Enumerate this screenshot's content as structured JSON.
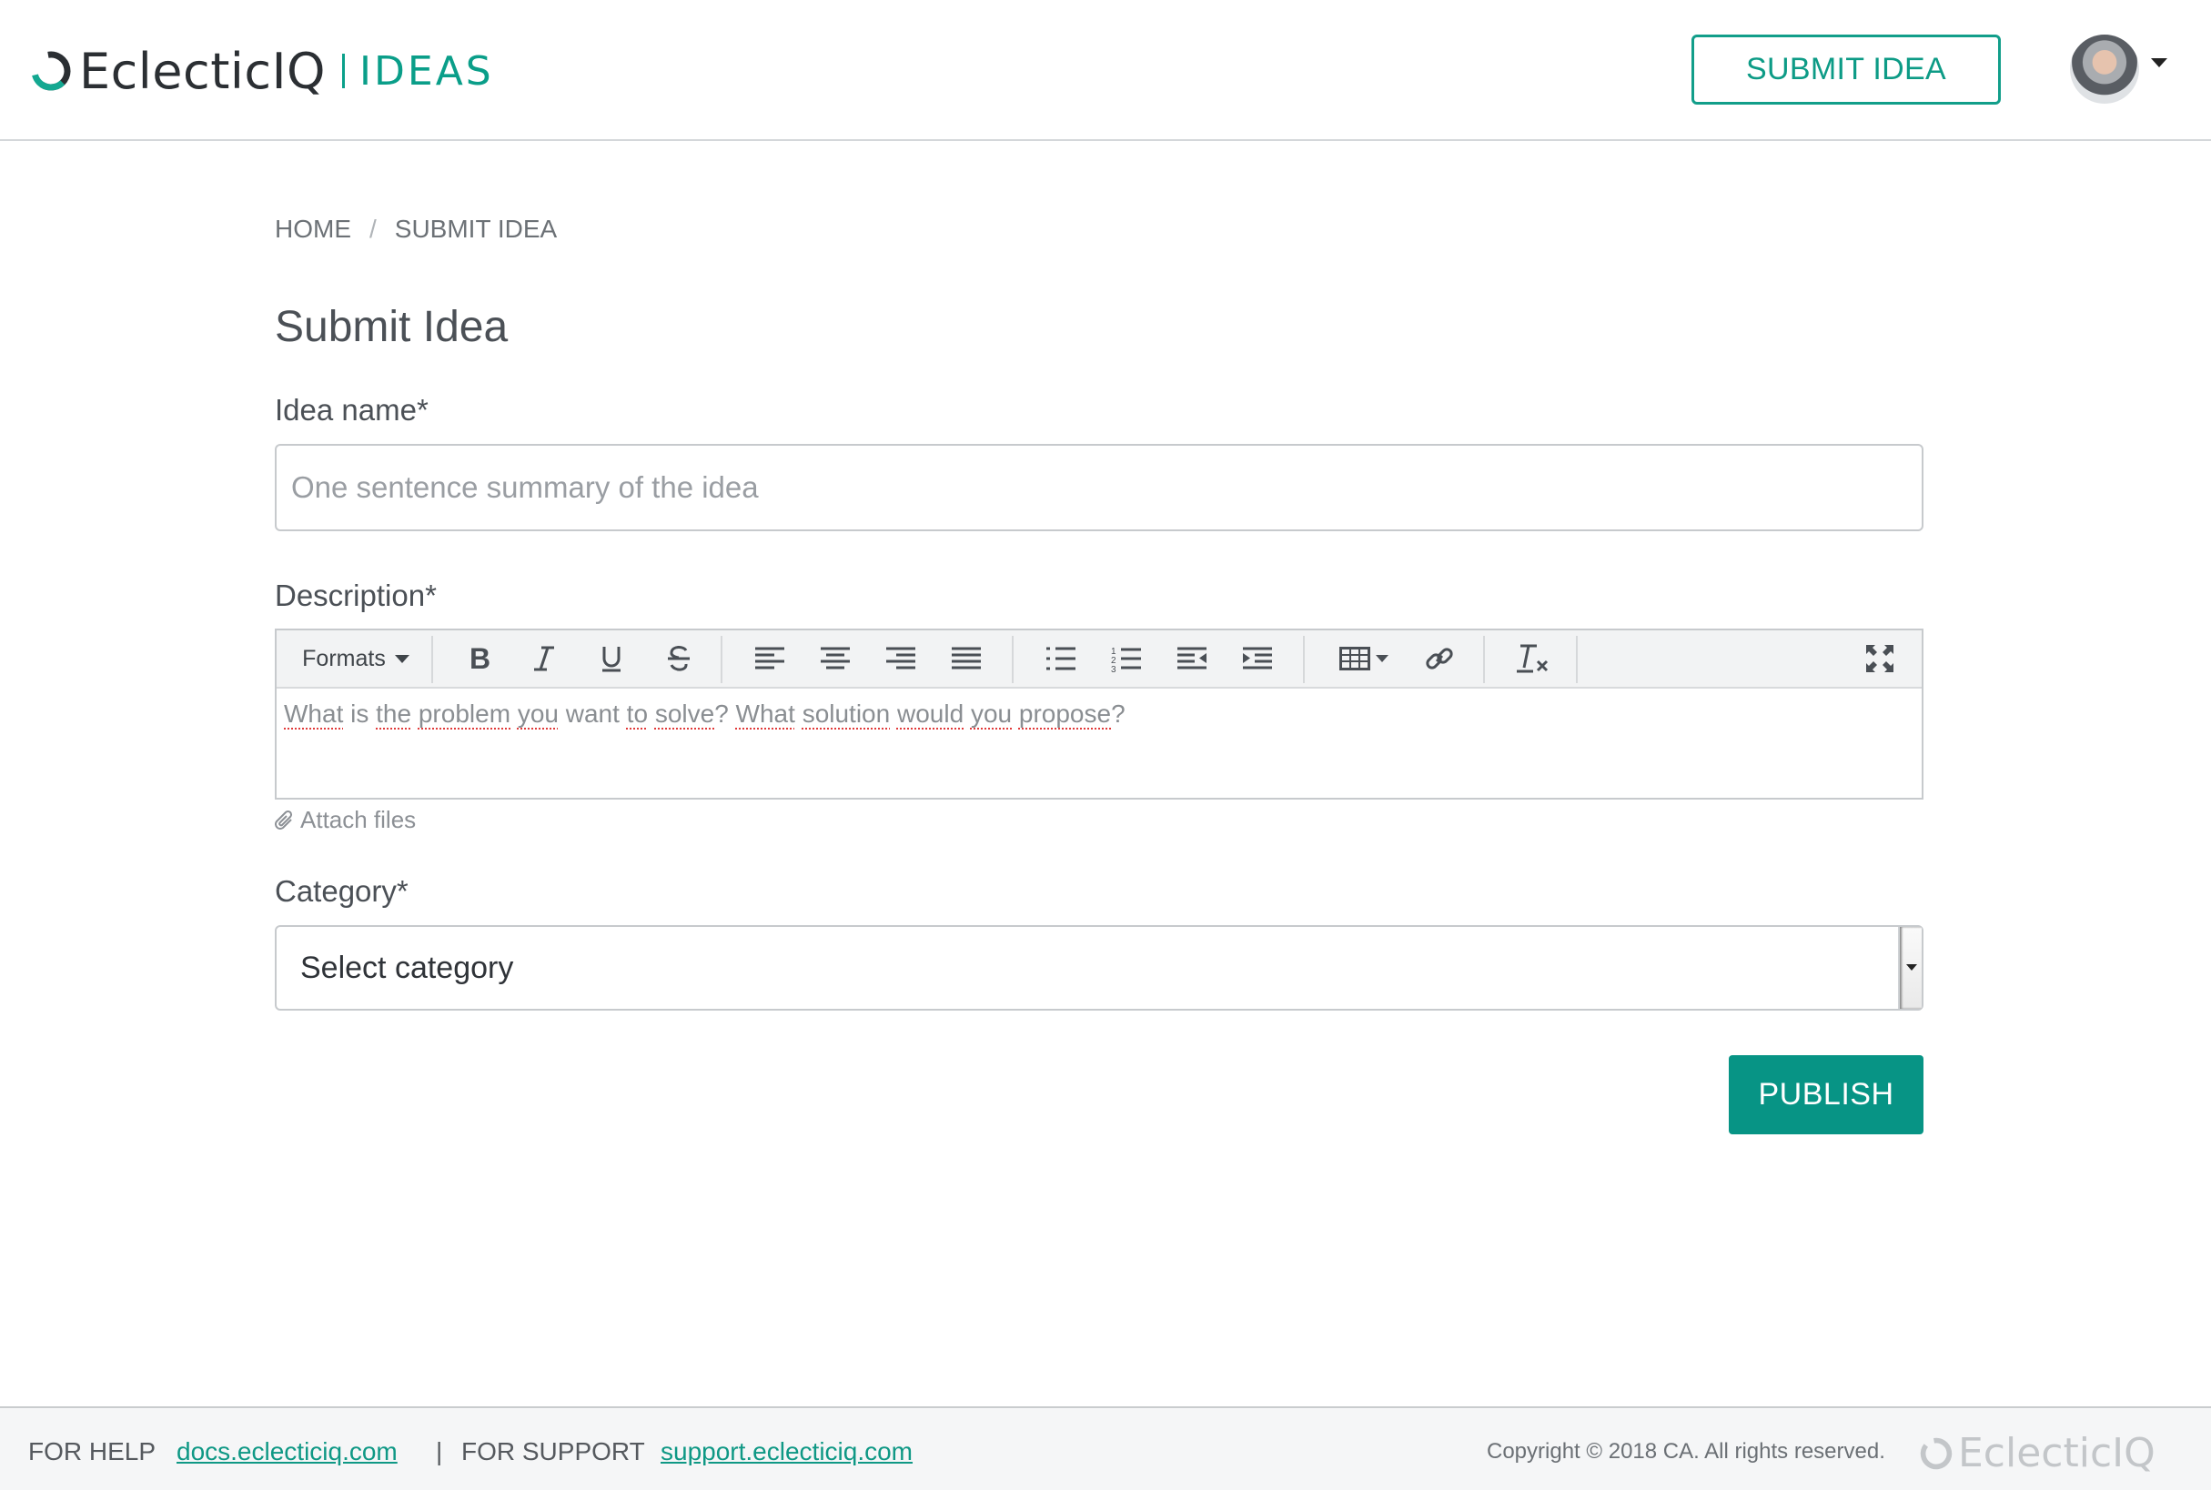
{
  "header": {
    "brand": "EclecticIQ",
    "app_name": "IDEAS",
    "submit_button": "SUBMIT IDEA",
    "colors": {
      "accent": "#0a9e89",
      "publish_bg": "#079485"
    }
  },
  "breadcrumb": {
    "home": "HOME",
    "separator": "/",
    "current": "SUBMIT IDEA"
  },
  "page": {
    "title": "Submit Idea"
  },
  "form": {
    "idea_name": {
      "label": "Idea name*",
      "placeholder": "One sentence summary of the idea",
      "value": ""
    },
    "description": {
      "label": "Description*",
      "toolbar": {
        "formats_label": "Formats",
        "buttons": [
          "bold-icon",
          "italic-icon",
          "underline-icon",
          "strikethrough-icon",
          "align-left-icon",
          "align-center-icon",
          "align-right-icon",
          "align-justify-icon",
          "bullet-list-icon",
          "numbered-list-icon",
          "outdent-icon",
          "indent-icon",
          "table-icon",
          "link-icon",
          "clear-formatting-icon",
          "fullscreen-icon"
        ]
      },
      "placeholder_parts": [
        "What",
        " is ",
        "the",
        " ",
        "problem",
        " ",
        "you",
        " want ",
        "to",
        " ",
        "solve",
        "? ",
        "What",
        " ",
        "solution",
        " ",
        "would",
        " ",
        "you",
        " ",
        "propose",
        "?"
      ]
    },
    "attach_files": "Attach files",
    "category": {
      "label": "Category*",
      "selected": "Select category"
    },
    "publish_button": "PUBLISH"
  },
  "footer": {
    "help_label": "FOR HELP",
    "help_link": "docs.eclecticiq.com",
    "divider": "|",
    "support_label": "FOR SUPPORT",
    "support_link": "support.eclecticiq.com",
    "copyright": "Copyright © 2018 CA. All rights reserved.",
    "brand": "EclecticIQ"
  }
}
